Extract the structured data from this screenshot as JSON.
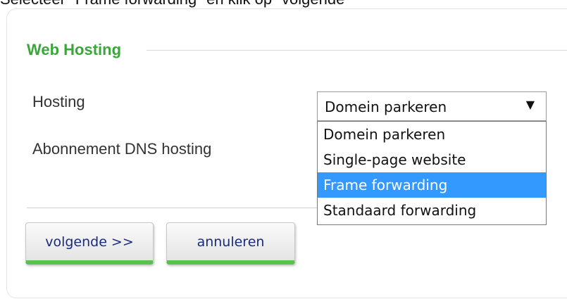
{
  "instruction": "Selecteer \"Frame forwarding\" en klik op \"volgende\"",
  "section": {
    "title": "Web Hosting"
  },
  "fields": {
    "hosting_label": "Hosting",
    "dns_label": "Abonnement DNS hosting"
  },
  "hosting_select": {
    "value": "Domein parkeren",
    "arrow": "▼",
    "options": [
      "Domein parkeren",
      "Single-page website",
      "Frame forwarding",
      "Standaard forwarding"
    ],
    "highlighted_index": 2
  },
  "buttons": {
    "next": "volgende >>",
    "cancel": "annuleren"
  },
  "colors": {
    "legend": "#3aa63a",
    "highlight": "#3399ff",
    "button_accent": "#58c34c",
    "button_text": "#1a2b7a"
  }
}
